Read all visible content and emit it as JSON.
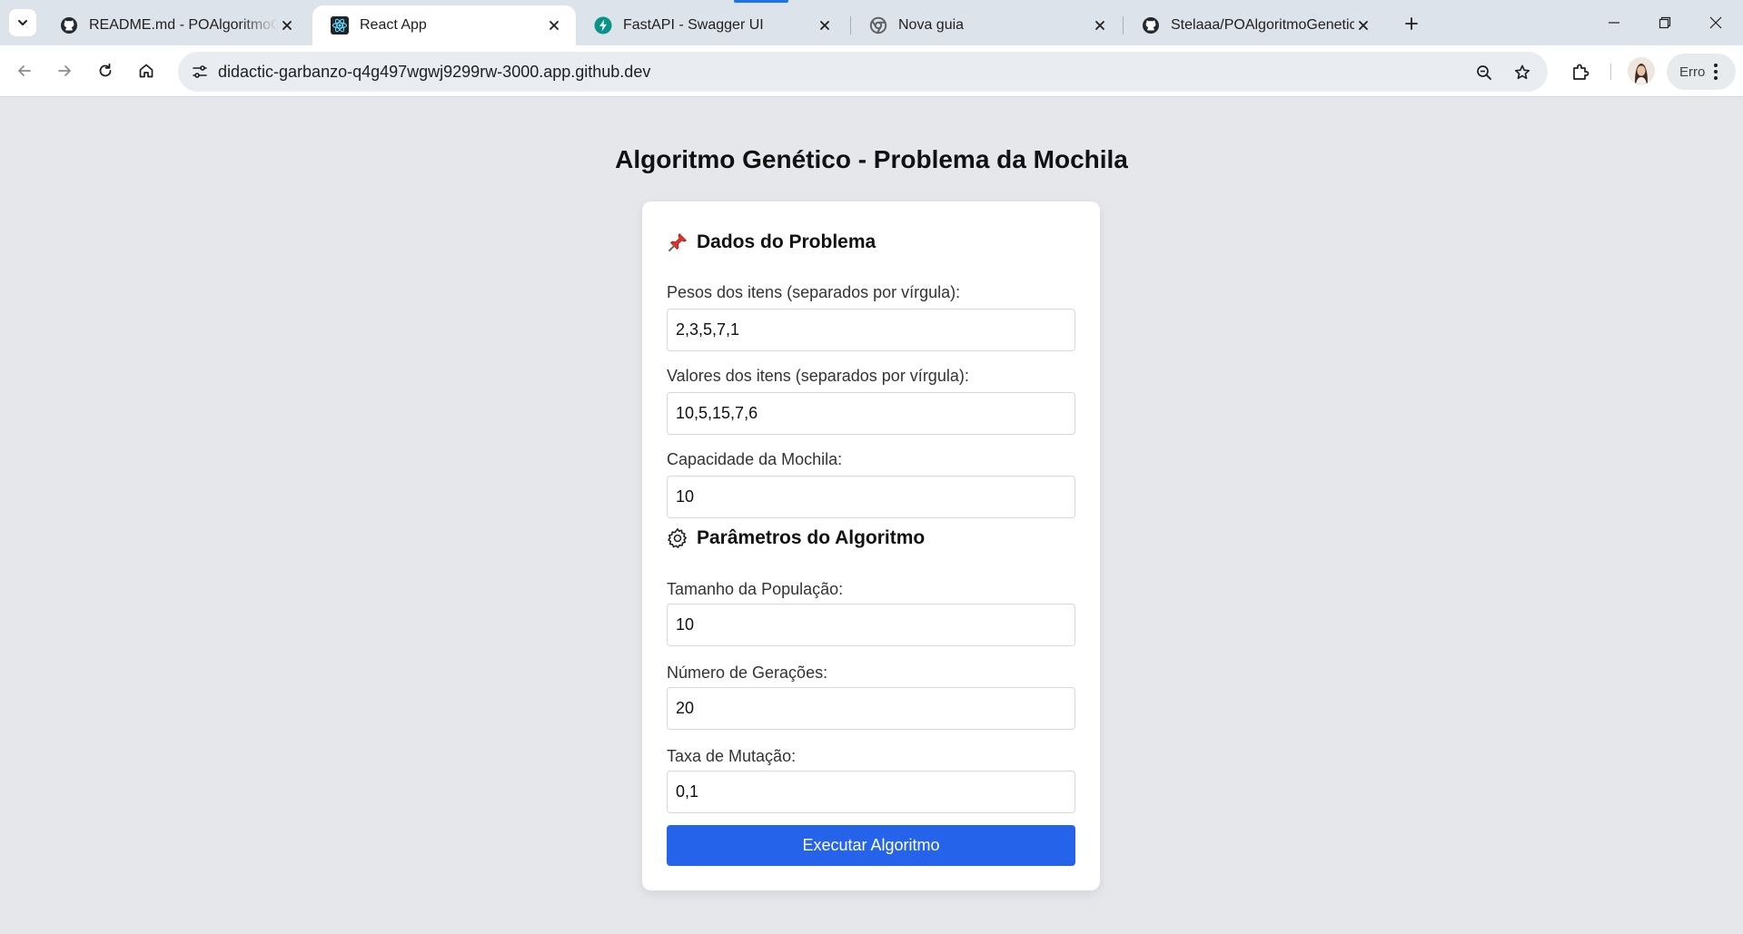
{
  "browser": {
    "tabs": [
      {
        "title": "README.md - POAlgoritmoGenetico",
        "favicon": "github-icon"
      },
      {
        "title": "React App",
        "favicon": "react-icon",
        "active": true
      },
      {
        "title": "FastAPI - Swagger UI",
        "favicon": "fastapi-icon"
      },
      {
        "title": "Nova guia",
        "favicon": "chrome-icon"
      },
      {
        "title": "Stelaaa/POAlgoritmoGenetico_",
        "favicon": "github-icon"
      }
    ],
    "url": "didactic-garbanzo-q4g497wgwj9299rw-3000.app.github.dev",
    "profile_label": "Erro"
  },
  "page": {
    "title": "Algoritmo Genético - Problema da Mochila",
    "problem_section": {
      "heading": "Dados do Problema",
      "icon": "pushpin-icon",
      "fields": [
        {
          "label": "Pesos dos itens (separados por vírgula):",
          "value": "2,3,5,7,1"
        },
        {
          "label": "Valores dos itens (separados por vírgula):",
          "value": "10,5,15,7,6"
        },
        {
          "label": "Capacidade da Mochila:",
          "value": "10"
        }
      ]
    },
    "algorithm_section": {
      "heading": "Parâmetros do Algoritmo",
      "icon": "gear-icon",
      "fields": [
        {
          "label": "Tamanho da População:",
          "value": "10"
        },
        {
          "label": "Número de Gerações:",
          "value": "20"
        },
        {
          "label": "Taxa de Mutação:",
          "value": "0,1"
        }
      ]
    },
    "submit_label": "Executar Algoritmo"
  },
  "colors": {
    "page_background": "#e5e7eb",
    "card_background": "#ffffff",
    "button_primary": "#2563eb",
    "tab_strip": "#dde3ea"
  }
}
